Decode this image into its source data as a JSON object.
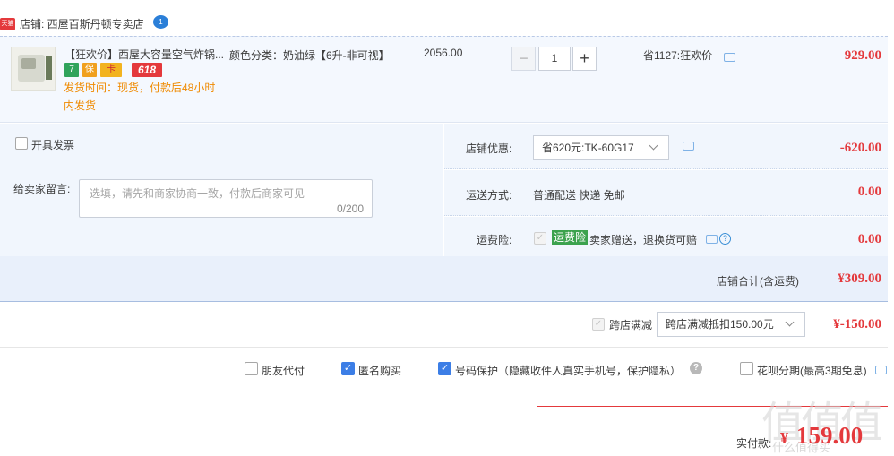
{
  "shop": {
    "tmall_badge": "天猫",
    "label": "店铺: 西屋百斯丹顿专卖店",
    "chat_badge": "1"
  },
  "item": {
    "title": "【狂欢价】西屋大容量空气炸锅...",
    "service_badges": [
      "7",
      "保",
      "卡",
      "618"
    ],
    "delivery": "发货时间：现货，付款后48小时内发货",
    "spec": "颜色分类：奶油绿【6升-非可视】",
    "unit_price": "2056.00",
    "quantity": "1",
    "qty_minus": "−",
    "qty_plus": "+",
    "promo": "省1127:狂欢价",
    "total": "929.00"
  },
  "options": {
    "invoice_label": "开具发票",
    "message_label": "给卖家留言:",
    "message_placeholder": "选填，请先和商家协商一致，付款后商家可见",
    "message_count": "0/200",
    "coupon_label": "店铺优惠:",
    "coupon_selected": "省620元:TK-60G17",
    "coupon_amount": "-620.00",
    "ship_label": "运送方式:",
    "ship_value": "普通配送 快递 免邮",
    "ship_amount": "0.00",
    "insurance_label": "运费险:",
    "insurance_check": "✓",
    "insurance_tag": "运费险",
    "insurance_desc": "卖家赠送，退换货可赔",
    "insurance_help": "?",
    "insurance_amount": "0.00"
  },
  "subtotal": {
    "label": "店铺合计(含运费)",
    "amount": "¥309.00"
  },
  "cross_store": {
    "check": "✓",
    "label": "跨店满减",
    "selected": "跨店满减抵扣150.00元",
    "amount": "¥-150.00"
  },
  "checkboxes": {
    "friend_pay": "朋友代付",
    "anonymous": "匿名购买",
    "privacy": "号码保护（隐藏收件人真实手机号，保护隐私）",
    "privacy_help": "?",
    "huabei": "花呗分期(最高3期免息)",
    "check_mark": "✓"
  },
  "pay": {
    "label": "实付款:",
    "currency": "¥",
    "amount": "159.00"
  },
  "watermark": {
    "mark": "值值值",
    "site": "什么值得买"
  },
  "colors": {
    "accent_red": "#e4393c",
    "accent_blue": "#3c7ee6",
    "insurance_green": "#3ca24e",
    "delivery_orange": "#ef8a00"
  }
}
